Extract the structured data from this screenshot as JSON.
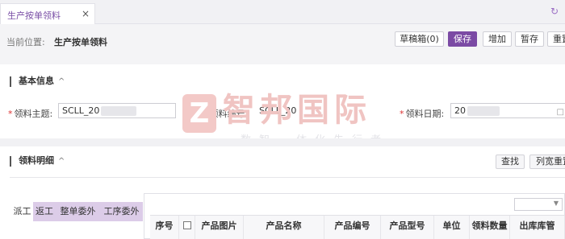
{
  "tab": {
    "title": "生产按单领料",
    "close_glyph": "×"
  },
  "refresh_icon": "refresh-icon",
  "position": {
    "label": "当前位置:",
    "value": "生产按单领料"
  },
  "toolbar": {
    "draft_label": "草稿箱(0)",
    "save_label": "保存",
    "add_label": "增加",
    "hold_label": "暂存",
    "reset_label": "重置"
  },
  "basic_section": {
    "title": "基本信息",
    "chevron": "^"
  },
  "form": {
    "subject_label": "领料主题:",
    "subject_value": "SCLL_20",
    "number_label": "领料编号:",
    "number_value": "SCLL_20",
    "date_label": "领料日期:",
    "date_value": "20"
  },
  "watermark": {
    "logo": "Z",
    "name": "智邦国际",
    "slogan": "数智一体化先行者"
  },
  "detail_section": {
    "title": "领料明细",
    "chevron": "^"
  },
  "detail_buttons": {
    "find_label": "查找",
    "column_reset_label": "列宽重置"
  },
  "subtabs": [
    {
      "label": "派工"
    },
    {
      "label": "返工"
    },
    {
      "label": "整单委外"
    },
    {
      "label": "工序委外"
    }
  ],
  "table": {
    "columns": [
      "序号",
      "",
      "产品图片",
      "产品名称",
      "产品编号",
      "产品型号",
      "单位",
      "领料数量",
      "出库库管"
    ]
  },
  "colors": {
    "accent": "#7b4aa4",
    "tab_text": "#7a4fa6",
    "subtab_bg": "#dccce8"
  }
}
